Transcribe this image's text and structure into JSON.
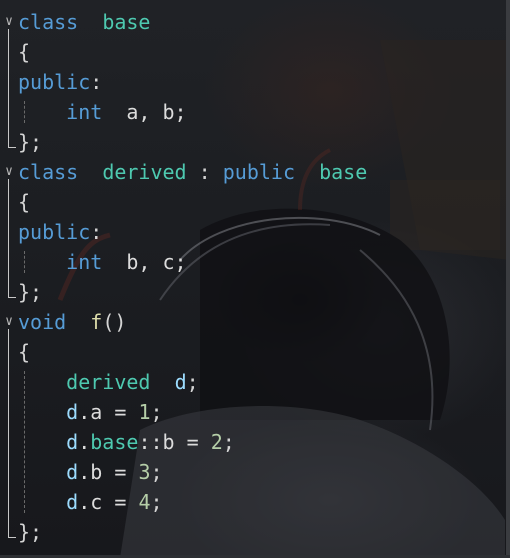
{
  "editor": {
    "lines": [
      {
        "fold": "chevron",
        "tokens": [
          {
            "t": "class",
            "c": "kw"
          },
          {
            "t": "  ",
            "c": "plain"
          },
          {
            "t": "base",
            "c": "ty"
          }
        ]
      },
      {
        "fold": "none",
        "tokens": [
          {
            "t": "{",
            "c": "op"
          }
        ]
      },
      {
        "fold": "none",
        "tokens": [
          {
            "t": "public",
            "c": "kw"
          },
          {
            "t": ":",
            "c": "op"
          }
        ]
      },
      {
        "fold": "none",
        "tokens": [
          {
            "t": "    ",
            "c": "plain"
          },
          {
            "t": "int",
            "c": "kw"
          },
          {
            "t": "  a, b;",
            "c": "plain"
          }
        ]
      },
      {
        "fold": "none",
        "tokens": [
          {
            "t": "};",
            "c": "op"
          }
        ]
      },
      {
        "fold": "chevron",
        "tokens": [
          {
            "t": "class",
            "c": "kw"
          },
          {
            "t": "  ",
            "c": "plain"
          },
          {
            "t": "derived",
            "c": "ty"
          },
          {
            "t": " : ",
            "c": "op"
          },
          {
            "t": "public",
            "c": "kw"
          },
          {
            "t": "  ",
            "c": "plain"
          },
          {
            "t": "base",
            "c": "ty"
          }
        ]
      },
      {
        "fold": "none",
        "tokens": [
          {
            "t": "{",
            "c": "op"
          }
        ]
      },
      {
        "fold": "none",
        "tokens": [
          {
            "t": "public",
            "c": "kw"
          },
          {
            "t": ":",
            "c": "op"
          }
        ]
      },
      {
        "fold": "none",
        "tokens": [
          {
            "t": "    ",
            "c": "plain"
          },
          {
            "t": "int",
            "c": "kw"
          },
          {
            "t": "  b, c;",
            "c": "plain"
          }
        ]
      },
      {
        "fold": "none",
        "tokens": [
          {
            "t": "};",
            "c": "op"
          }
        ]
      },
      {
        "fold": "chevron",
        "tokens": [
          {
            "t": "void",
            "c": "kw"
          },
          {
            "t": "  ",
            "c": "plain"
          },
          {
            "t": "f",
            "c": "fn"
          },
          {
            "t": "()",
            "c": "op"
          }
        ]
      },
      {
        "fold": "none",
        "tokens": [
          {
            "t": "{",
            "c": "op"
          }
        ]
      },
      {
        "fold": "none",
        "tokens": [
          {
            "t": "    ",
            "c": "plain"
          },
          {
            "t": "derived",
            "c": "ty"
          },
          {
            "t": "  ",
            "c": "plain"
          },
          {
            "t": "d",
            "c": "var-d"
          },
          {
            "t": ";",
            "c": "op"
          }
        ]
      },
      {
        "fold": "none",
        "tokens": [
          {
            "t": "    ",
            "c": "plain"
          },
          {
            "t": "d",
            "c": "var"
          },
          {
            "t": ".a = ",
            "c": "plain"
          },
          {
            "t": "1",
            "c": "num"
          },
          {
            "t": ";",
            "c": "op"
          }
        ]
      },
      {
        "fold": "none",
        "tokens": [
          {
            "t": "    ",
            "c": "plain"
          },
          {
            "t": "d",
            "c": "var"
          },
          {
            "t": ".",
            "c": "plain"
          },
          {
            "t": "base",
            "c": "ty"
          },
          {
            "t": "::b = ",
            "c": "plain"
          },
          {
            "t": "2",
            "c": "num"
          },
          {
            "t": ";",
            "c": "op"
          }
        ]
      },
      {
        "fold": "none",
        "tokens": [
          {
            "t": "    ",
            "c": "plain"
          },
          {
            "t": "d",
            "c": "var"
          },
          {
            "t": ".b = ",
            "c": "plain"
          },
          {
            "t": "3",
            "c": "num"
          },
          {
            "t": ";",
            "c": "op"
          }
        ]
      },
      {
        "fold": "none",
        "tokens": [
          {
            "t": "    ",
            "c": "plain"
          },
          {
            "t": "d",
            "c": "var"
          },
          {
            "t": ".c = ",
            "c": "plain"
          },
          {
            "t": "4",
            "c": "num"
          },
          {
            "t": ";",
            "c": "op"
          }
        ]
      },
      {
        "fold": "none",
        "tokens": [
          {
            "t": "};",
            "c": "op"
          }
        ]
      }
    ]
  },
  "colors": {
    "keyword": "#569cd6",
    "type": "#4ec9b0",
    "function": "#dcdcaa",
    "number": "#b5cea8",
    "variable": "#9cdcfe",
    "plain": "#dcdcdc"
  }
}
